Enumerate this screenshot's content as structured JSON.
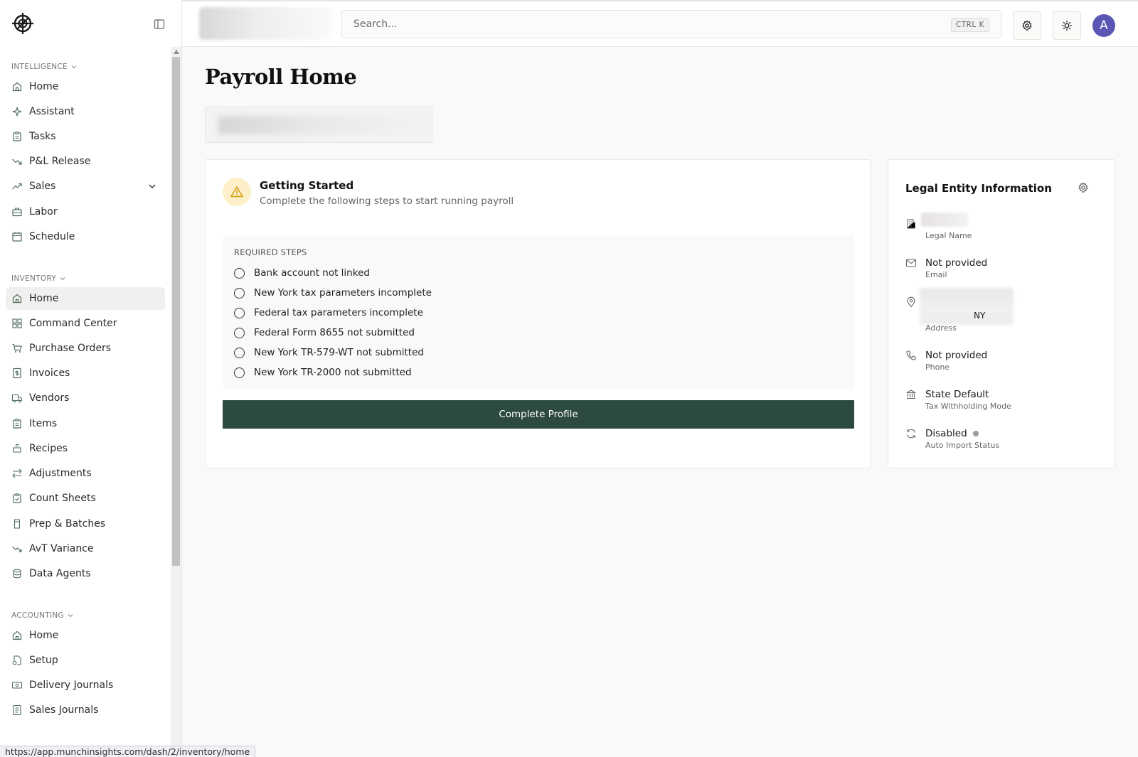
{
  "sidebar": {
    "sections": [
      {
        "label": "INTELLIGENCE",
        "items": [
          {
            "label": "Home",
            "icon": "home-icon"
          },
          {
            "label": "Assistant",
            "icon": "sparkles-icon"
          },
          {
            "label": "Tasks",
            "icon": "clipboard-icon"
          },
          {
            "label": "P&L Release",
            "icon": "trend-down-icon"
          },
          {
            "label": "Sales",
            "icon": "trend-up-icon"
          },
          {
            "label": "Labor",
            "icon": "briefcase-icon"
          },
          {
            "label": "Schedule",
            "icon": "calendar-icon"
          }
        ]
      },
      {
        "label": "INVENTORY",
        "items": [
          {
            "label": "Home",
            "icon": "home-icon"
          },
          {
            "label": "Command Center",
            "icon": "grid-icon"
          },
          {
            "label": "Purchase Orders",
            "icon": "cart-icon"
          },
          {
            "label": "Invoices",
            "icon": "invoice-icon"
          },
          {
            "label": "Vendors",
            "icon": "truck-icon"
          },
          {
            "label": "Items",
            "icon": "clipboard-icon"
          },
          {
            "label": "Recipes",
            "icon": "cooking-pot-icon"
          },
          {
            "label": "Adjustments",
            "icon": "arrows-left-right-icon"
          },
          {
            "label": "Count Sheets",
            "icon": "clipboard-check-icon"
          },
          {
            "label": "Prep & Batches",
            "icon": "container-icon"
          },
          {
            "label": "AvT Variance",
            "icon": "trend-down-icon"
          },
          {
            "label": "Data Agents",
            "icon": "database-icon"
          }
        ]
      },
      {
        "label": "ACCOUNTING",
        "items": [
          {
            "label": "Home",
            "icon": "home-icon"
          },
          {
            "label": "Setup",
            "icon": "file-settings-icon"
          },
          {
            "label": "Delivery Journals",
            "icon": "banknote-icon"
          },
          {
            "label": "Sales Journals",
            "icon": "notebook-icon"
          }
        ]
      }
    ],
    "active_item": "INVENTORY/Home"
  },
  "topbar": {
    "search_placeholder": "Search...",
    "shortcut": "CTRL K",
    "avatar_initial": "A"
  },
  "page": {
    "title": "Payroll Home"
  },
  "getting_started": {
    "title": "Getting Started",
    "subtitle": "Complete the following steps to start running payroll",
    "steps_label": "REQUIRED STEPS",
    "steps": [
      "Bank account not linked",
      "New York tax parameters incomplete",
      "Federal tax parameters incomplete",
      "Federal Form 8655 not submitted",
      "New York TR-579-WT not submitted",
      "New York TR-2000 not submitted"
    ],
    "cta": "Complete Profile"
  },
  "legal_entity": {
    "title": "Legal Entity Information",
    "fields": [
      {
        "value": "",
        "label": "Legal Name",
        "icon": "building-icon"
      },
      {
        "value": "Not provided",
        "label": "Email",
        "icon": "mail-icon"
      },
      {
        "value": "NY",
        "label": "Address",
        "icon": "map-pin-icon"
      },
      {
        "value": "Not provided",
        "label": "Phone",
        "icon": "phone-icon"
      },
      {
        "value": "State Default",
        "label": "Tax Withholding Mode",
        "icon": "landmark-icon"
      },
      {
        "value": "Disabled",
        "label": "Auto Import Status",
        "icon": "refresh-icon"
      }
    ]
  },
  "status_bar": {
    "url": "https://app.munchinsights.com/dash/2/inventory/home"
  },
  "colors": {
    "primary_button": "#2d4a3e",
    "avatar": "#5a56b4",
    "warning_bg": "#fdf0c8",
    "warning_icon": "#d4a017"
  }
}
